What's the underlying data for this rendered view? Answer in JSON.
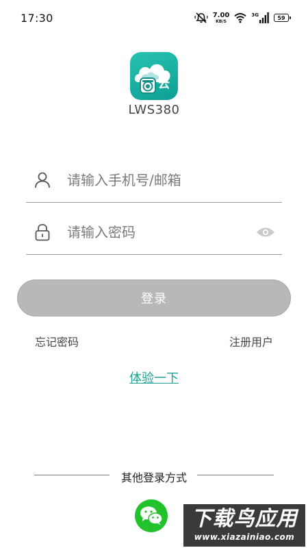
{
  "status_bar": {
    "time": "17:30",
    "net_speed_value": "7.00",
    "net_speed_unit": "KB/S",
    "network_type": "3G",
    "battery": "59",
    "icons": [
      "mute-icon",
      "wifi-icon",
      "cellular-signal-icon",
      "battery-icon"
    ]
  },
  "app": {
    "logo_text": "云",
    "name": "LWS380",
    "brand_color": "#15ac9f"
  },
  "login_form": {
    "username_placeholder": "请输入手机号/邮箱",
    "username_value": "",
    "password_placeholder": "请输入密码",
    "password_value": "",
    "login_label": "登录",
    "forgot_password": "忘记密码",
    "register": "注册用户",
    "try_it": "体验一下",
    "try_color": "#1aa394",
    "button_color": "#b8b8b8"
  },
  "other_login": {
    "label": "其他登录方式",
    "options": [
      "wechat-icon"
    ]
  },
  "watermark": {
    "logo_text": "下载鸟应用",
    "url": "www.xiazainiao.com"
  }
}
